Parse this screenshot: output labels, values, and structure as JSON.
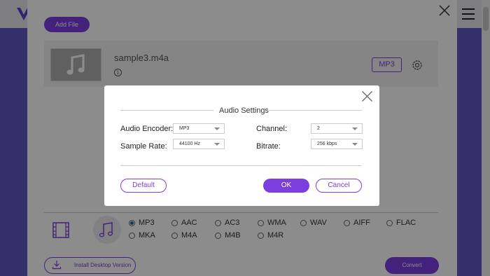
{
  "toolbar": {
    "add_file_label": "Add File"
  },
  "file": {
    "name": "sample3.m4a",
    "info_glyph": "i",
    "format_badge": "MP3"
  },
  "format_bar": {
    "options": [
      {
        "label": "MP3",
        "selected": true
      },
      {
        "label": "AAC",
        "selected": false
      },
      {
        "label": "AC3",
        "selected": false
      },
      {
        "label": "WMA",
        "selected": false
      },
      {
        "label": "WAV",
        "selected": false
      },
      {
        "label": "AIFF",
        "selected": false
      },
      {
        "label": "FLAC",
        "selected": false
      },
      {
        "label": "MKA",
        "selected": false
      },
      {
        "label": "M4A",
        "selected": false
      },
      {
        "label": "M4B",
        "selected": false
      },
      {
        "label": "M4R",
        "selected": false
      }
    ]
  },
  "footer": {
    "install_label": "Install Desktop Version",
    "convert_label": "Convert"
  },
  "dialog": {
    "title": "Audio Settings",
    "encoder_label": "Audio Encoder:",
    "encoder_value": "MP3",
    "channel_label": "Channel:",
    "channel_value": "2",
    "sample_rate_label": "Sample Rate:",
    "sample_rate_value": "44100 Hz",
    "bitrate_label": "Bitrate:",
    "bitrate_value": "256 kbps",
    "default_label": "Default",
    "ok_label": "OK",
    "cancel_label": "Cancel"
  },
  "colors": {
    "accent": "#7d3ee0",
    "radio_selected": "#2b5fc7",
    "brand_band": "#6256c4"
  },
  "icons": {
    "logo": "brand-logo-icon",
    "menu": "hamburger-menu-icon",
    "close": "close-icon",
    "music_note": "music-note-icon",
    "info": "info-icon",
    "settings": "gear-icon",
    "video": "film-icon",
    "download": "download-icon"
  }
}
